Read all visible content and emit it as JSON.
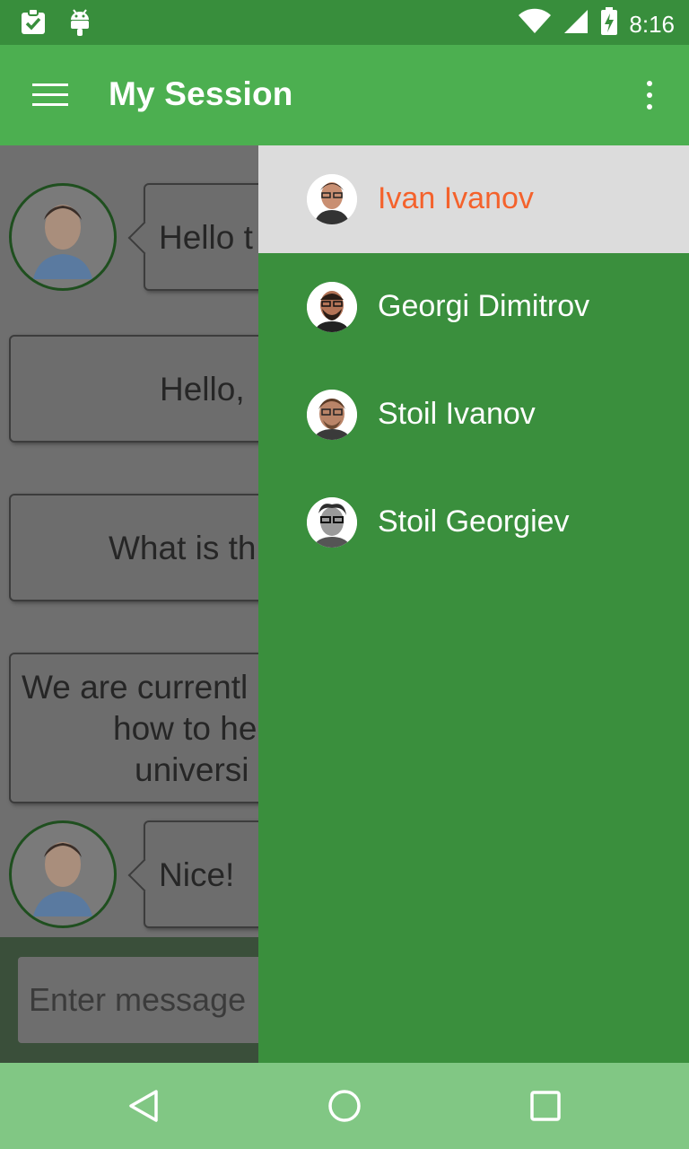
{
  "status_bar": {
    "time": "8:16",
    "icons": [
      "clipboard-check-icon",
      "android-icon",
      "wifi-icon",
      "signal-icon",
      "battery-charging-icon"
    ]
  },
  "app_bar": {
    "title": "My Session",
    "menu_icon": "hamburger-icon",
    "overflow_icon": "more-vert-icon"
  },
  "chat": {
    "messages": [
      {
        "side": "left",
        "text": "Hello t",
        "has_avatar": true
      },
      {
        "side": "full",
        "text": "Hello,"
      },
      {
        "side": "full",
        "text": "What is th"
      },
      {
        "side": "full",
        "lines": [
          "We are currentl",
          "how to he",
          "universi"
        ]
      },
      {
        "side": "left",
        "text": "Nice!",
        "has_avatar": true
      }
    ]
  },
  "input": {
    "placeholder": "Enter message"
  },
  "drawer": {
    "items": [
      {
        "name": "Ivan Ivanov",
        "selected": true
      },
      {
        "name": "Georgi Dimitrov",
        "selected": false
      },
      {
        "name": "Stoil Ivanov",
        "selected": false
      },
      {
        "name": "Stoil Georgiev",
        "selected": false
      }
    ]
  },
  "nav_bar": {
    "back": "back-icon",
    "home": "home-icon",
    "recents": "recents-icon"
  },
  "colors": {
    "status_bar": "#388e3c",
    "app_bar": "#4caf50",
    "drawer": "#3a8f3d",
    "selected_item_bg": "#dcdcdc",
    "selected_item_text": "#f4622c",
    "nav_bar": "#81c784"
  }
}
